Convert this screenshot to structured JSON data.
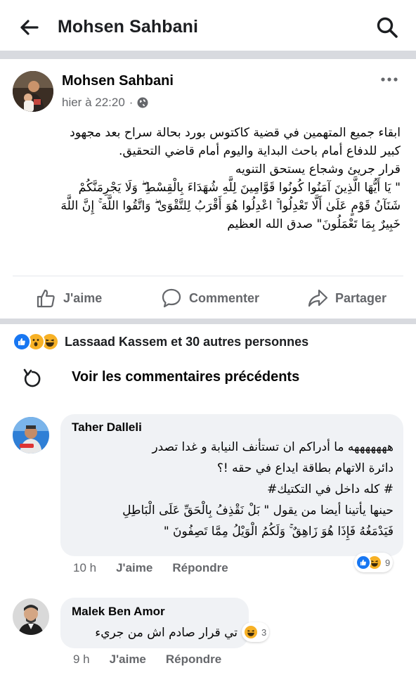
{
  "topbar": {
    "title": "Mohsen Sahbani",
    "back_icon": "arrow-left-icon",
    "search_icon": "search-icon"
  },
  "post": {
    "author": "Mohsen Sahbani",
    "time": "hier à 22:20",
    "privacy_icon": "globe-icon",
    "lines": [
      "ابقاء جميع المتهمين في قضية كاكتوس بورد بحالة سراح بعد مجهود",
      "كبير للدفاع أمام باحث البداية واليوم أمام قاضي التحقيق.",
      "قرار جريئ وشجاع يستحق التنويه",
      "\" يَا أَيُّهَا الَّذِينَ آمَنُوا كُونُوا قَوَّامِينَ لِلَّهِ شُهَدَاءَ بِالْقِسْطِ ۖ وَلَا يَجْرِمَنَّكُمْ",
      "شَنَآنُ قَوْمٍ عَلَىٰ أَلَّا تَعْدِلُوا ۚ اعْدِلُوا هُوَ أَقْرَبُ لِلتَّقْوَىٰ ۖ وَاتَّقُوا اللَّهَ ۚ إِنَّ اللَّهَ",
      "خَبِيرٌ بِمَا تَعْمَلُونَ\" صدق الله العظيم"
    ]
  },
  "actions": {
    "like": "J'aime",
    "comment": "Commenter",
    "share": "Partager"
  },
  "reactions": {
    "summary": "Lassaad Kassem et 30 autres personnes"
  },
  "previous_comments": "Voir les commentaires précédents",
  "comments": [
    {
      "name": "Taher Dalleli",
      "lines": [
        "هههههههه ما أدراكم ان تستأنف النيابة و غدا تصدر",
        "دائرة الاتهام بطاقة ايداع في حقه !؟",
        "# كله داخل في التكتيك#",
        "حينها يأتينا أيضا من يقول \" بَلْ نَقْذِفُ بِالْحَقِّ عَلَى الْبَاطِلِ",
        "فَيَدْمَغُهُ فَإِذَا هُوَ زَاهِقٌ ۚ وَلَكُمُ الْوَيْلُ مِمَّا تَصِفُونَ \""
      ],
      "time": "10 h",
      "like": "J'aime",
      "reply": "Répondre",
      "reaction_count": "9"
    },
    {
      "name": "Malek Ben Amor",
      "lines": [
        "تي قرار صادم اش من جريء"
      ],
      "time": "9 h",
      "like": "J'aime",
      "reply": "Répondre",
      "reaction_count": "3"
    }
  ],
  "colors": {
    "like_blue": "#1877f2",
    "haha_yellow": "#f7b125",
    "muted": "#65676b",
    "bubble": "#f0f2f5"
  }
}
